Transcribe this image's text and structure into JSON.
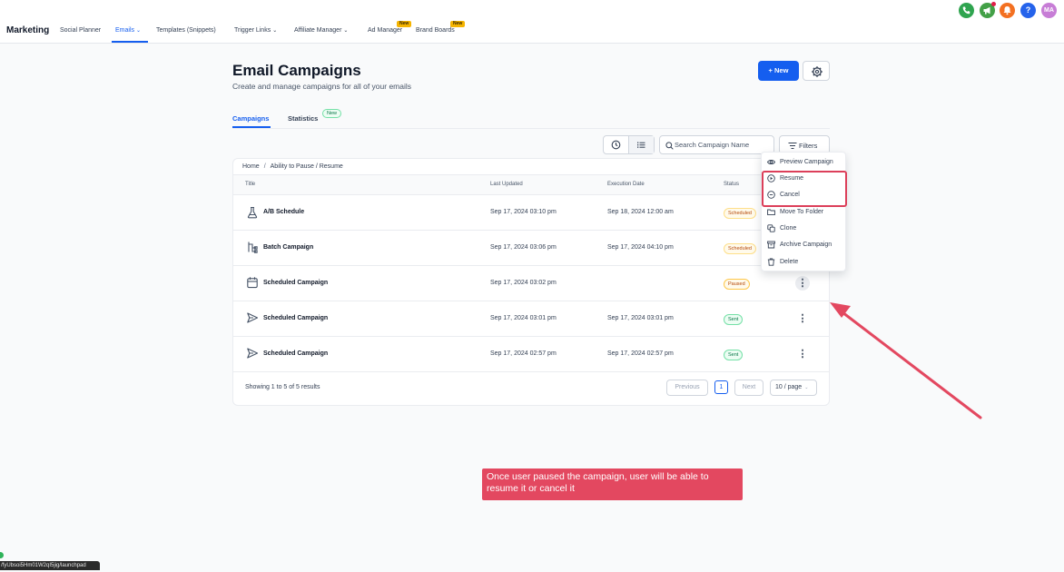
{
  "nav": {
    "brand": "Marketing",
    "items": [
      {
        "label": "Social Planner"
      },
      {
        "label": "Emails",
        "active": true
      },
      {
        "label": "Templates (Snippets)"
      },
      {
        "label": "Trigger Links"
      },
      {
        "label": "Affiliate Manager"
      },
      {
        "label": "Ad Manager",
        "badge": "New"
      },
      {
        "label": "Brand Boards",
        "badge": "New"
      }
    ],
    "avatar": "MA",
    "icon_colors": {
      "phone": "#2fa44f",
      "megaphone": "#43a047",
      "bell": "#f37021",
      "help": "#2563eb",
      "avatar": "#c77dd6"
    }
  },
  "header": {
    "title": "Email Campaigns",
    "subtitle": "Create and manage campaigns for all of your emails",
    "new_button": "New"
  },
  "tabs": [
    {
      "label": "Campaigns",
      "active": true
    },
    {
      "label": "Statistics",
      "badge": "New"
    }
  ],
  "toolbar": {
    "search_placeholder": "Search Campaign Name",
    "filters": "Filters"
  },
  "breadcrumb": {
    "home": "Home",
    "separator": "/",
    "current": "Ability to Pause / Resume"
  },
  "table": {
    "columns": [
      "Title",
      "Last Updated",
      "Execution Date",
      "Status"
    ],
    "rows": [
      {
        "icon": "flask-icon",
        "title": "A/B Schedule",
        "last_updated": "Sep 17, 2024 03:10 pm",
        "execution_date": "Sep 18, 2024 12:00 am",
        "status": "Scheduled"
      },
      {
        "icon": "branch-icon",
        "title": "Batch Campaign",
        "last_updated": "Sep 17, 2024 03:06 pm",
        "execution_date": "Sep 17, 2024 04:10 pm",
        "status": "Scheduled"
      },
      {
        "icon": "calendar-icon",
        "title": "Scheduled Campaign",
        "last_updated": "Sep 17, 2024 03:02 pm",
        "execution_date": "",
        "status": "Paused"
      },
      {
        "icon": "send-icon",
        "title": "Scheduled Campaign",
        "last_updated": "Sep 17, 2024 03:01 pm",
        "execution_date": "Sep 17, 2024 03:01 pm",
        "status": "Sent"
      },
      {
        "icon": "send-icon",
        "title": "Scheduled Campaign",
        "last_updated": "Sep 17, 2024 02:57 pm",
        "execution_date": "Sep 17, 2024 02:57 pm",
        "status": "Sent"
      }
    ]
  },
  "pagination": {
    "showing": "Showing 1 to 5 of 5 results",
    "previous": "Previous",
    "page": "1",
    "next": "Next",
    "page_size": "10 / page"
  },
  "menu": {
    "items": [
      "Preview Campaign",
      "Resume",
      "Cancel",
      "Move To Folder",
      "Clone",
      "Archive Campaign",
      "Delete"
    ]
  },
  "annotation": {
    "text": "Once user paused the campaign, user will be able to resume it or cancel it",
    "color": "#e34860"
  },
  "statusbar": {
    "url": "/fyUbsoi5Hm01W2qI5jig/launchpad"
  }
}
